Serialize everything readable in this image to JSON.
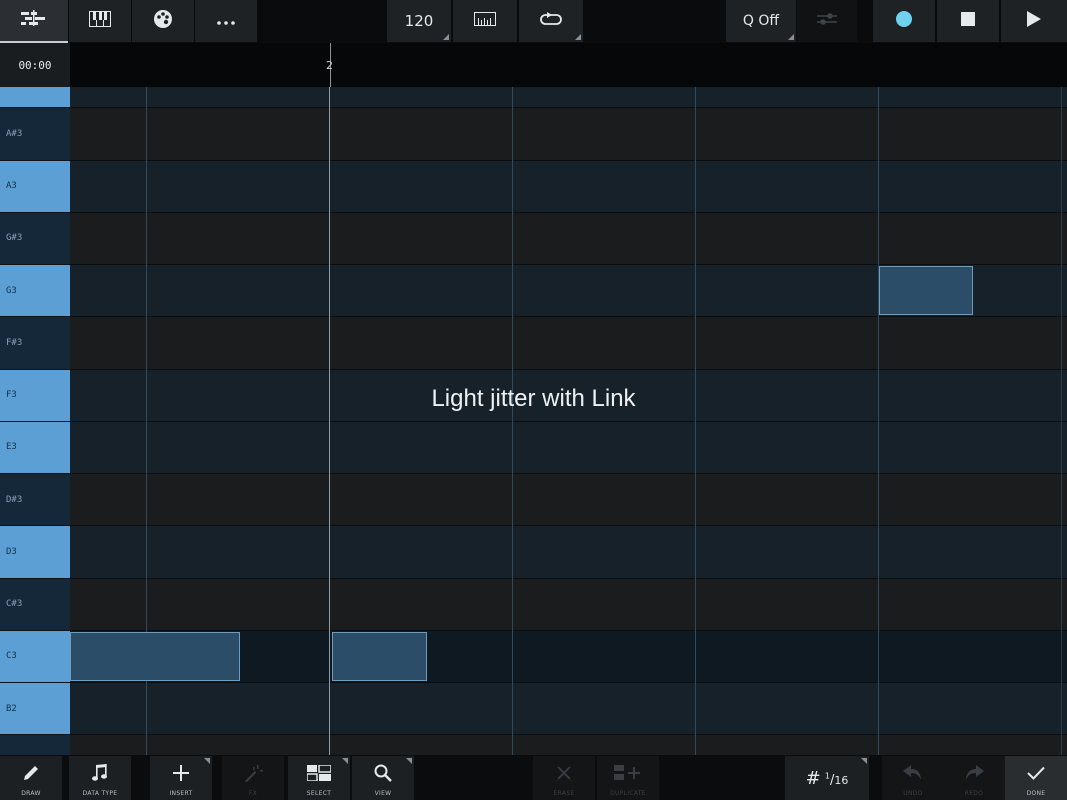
{
  "toolbar": {
    "tempo": "120",
    "quantize": "Q Off",
    "accent_color": "#6fd3f0"
  },
  "timeline": {
    "time": "00:00",
    "bar_label": "2"
  },
  "keys": [
    {
      "note": "",
      "type": "white"
    },
    {
      "note": "A#3",
      "type": "black"
    },
    {
      "note": "A3",
      "type": "white"
    },
    {
      "note": "G#3",
      "type": "black"
    },
    {
      "note": "G3",
      "type": "white"
    },
    {
      "note": "F#3",
      "type": "black"
    },
    {
      "note": "F3",
      "type": "white"
    },
    {
      "note": "E3",
      "type": "white"
    },
    {
      "note": "D#3",
      "type": "black"
    },
    {
      "note": "D3",
      "type": "white"
    },
    {
      "note": "C#3",
      "type": "black"
    },
    {
      "note": "C3",
      "type": "white"
    },
    {
      "note": "B2",
      "type": "white"
    },
    {
      "note": "",
      "type": "black"
    }
  ],
  "overlay_text": "Light jitter with Link",
  "bottom": {
    "draw": "DRAW",
    "data_type": "DATA TYPE",
    "insert": "INSERT",
    "magic": "FX",
    "select": "SELECT",
    "view": "VIEW",
    "delete": "ERASE",
    "duplicate": "DUPLICATE",
    "grid_num": "1",
    "grid_den": "16",
    "undo": "UNDO",
    "redo": "REDO",
    "done": "DONE"
  }
}
